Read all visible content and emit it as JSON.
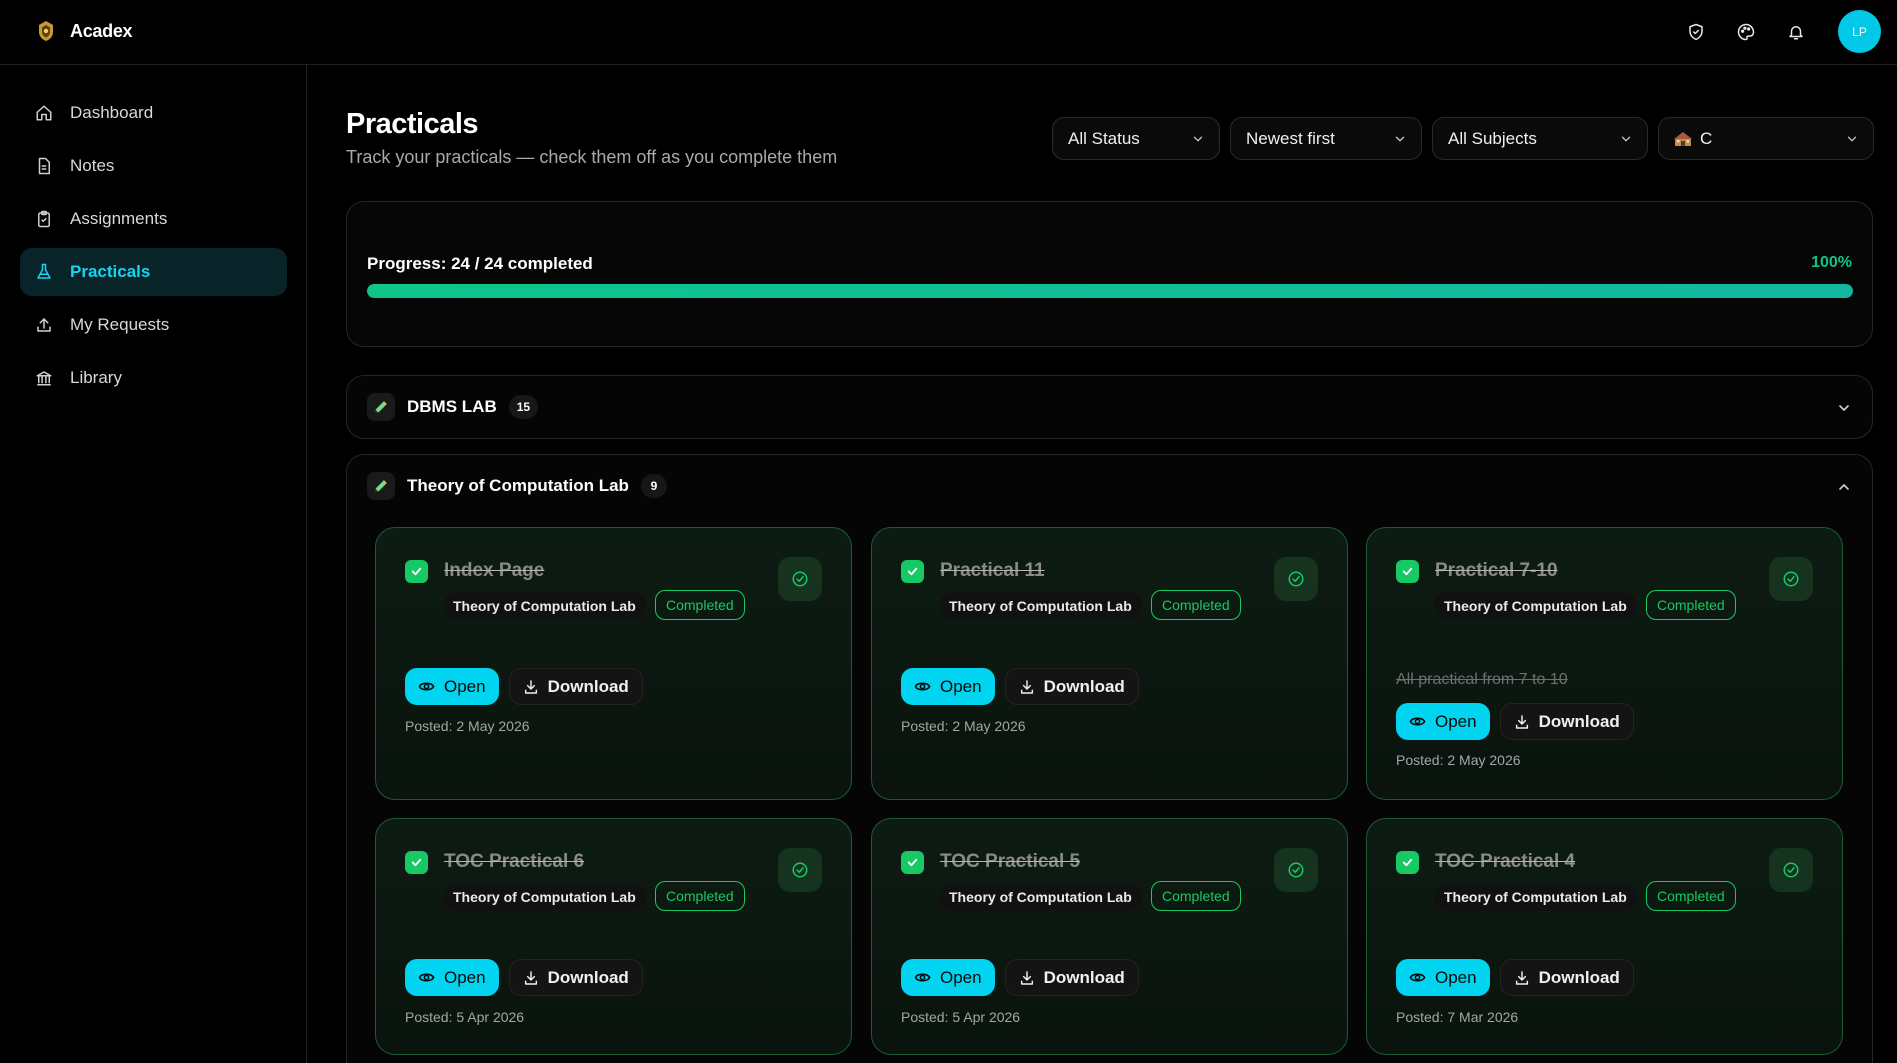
{
  "app": {
    "name": "Acadex",
    "avatar_initials": "LP"
  },
  "header": {
    "icons": [
      "shield-check-icon",
      "palette-icon",
      "bell-icon"
    ]
  },
  "sidebar": {
    "items": [
      {
        "label": "Dashboard",
        "icon": "home-icon",
        "active": false
      },
      {
        "label": "Notes",
        "icon": "file-icon",
        "active": false
      },
      {
        "label": "Assignments",
        "icon": "clipboard-icon",
        "active": false
      },
      {
        "label": "Practicals",
        "icon": "flask-icon",
        "active": true
      },
      {
        "label": "My Requests",
        "icon": "upload-icon",
        "active": false
      },
      {
        "label": "Library",
        "icon": "library-icon",
        "active": false
      }
    ]
  },
  "main": {
    "title": "Practicals",
    "subtitle": "Track your practicals — check them off as you complete them",
    "filters": {
      "status": "All Status",
      "sort": "Newest first",
      "subjects": "All Subjects",
      "section": "C"
    }
  },
  "progress": {
    "label": "Progress: 24 / 24 completed",
    "percent_text": "100%",
    "fraction": 1.0
  },
  "groups": [
    {
      "title": "DBMS LAB",
      "count": "15",
      "expanded": false
    },
    {
      "title": "Theory of Computation Lab",
      "count": "9",
      "expanded": true
    }
  ],
  "cards": [
    {
      "title": "Index Page",
      "subject": "Theory of Computation Lab",
      "status": "Completed",
      "description": "",
      "posted": "Posted: 2 May 2026",
      "open_label": "Open",
      "download_label": "Download"
    },
    {
      "title": "Practical 11",
      "subject": "Theory of Computation Lab",
      "status": "Completed",
      "description": "",
      "posted": "Posted: 2 May 2026",
      "open_label": "Open",
      "download_label": "Download"
    },
    {
      "title": "Practical 7-10",
      "subject": "Theory of Computation Lab",
      "status": "Completed",
      "description": "All practical from 7 to 10",
      "posted": "Posted: 2 May 2026",
      "open_label": "Open",
      "download_label": "Download"
    },
    {
      "title": "TOC Practical 6",
      "subject": "Theory of Computation Lab",
      "status": "Completed",
      "description": "",
      "posted": "Posted: 5 Apr 2026",
      "open_label": "Open",
      "download_label": "Download"
    },
    {
      "title": "TOC Practical 5",
      "subject": "Theory of Computation Lab",
      "status": "Completed",
      "description": "",
      "posted": "Posted: 5 Apr 2026",
      "open_label": "Open",
      "download_label": "Download"
    },
    {
      "title": "TOC Practical 4",
      "subject": "Theory of Computation Lab",
      "status": "Completed",
      "description": "",
      "posted": "Posted: 7 Mar 2026",
      "open_label": "Open",
      "download_label": "Download"
    }
  ],
  "colors": {
    "accent": "#00d4f0",
    "success": "#17c964",
    "progress": "#10c48a"
  }
}
